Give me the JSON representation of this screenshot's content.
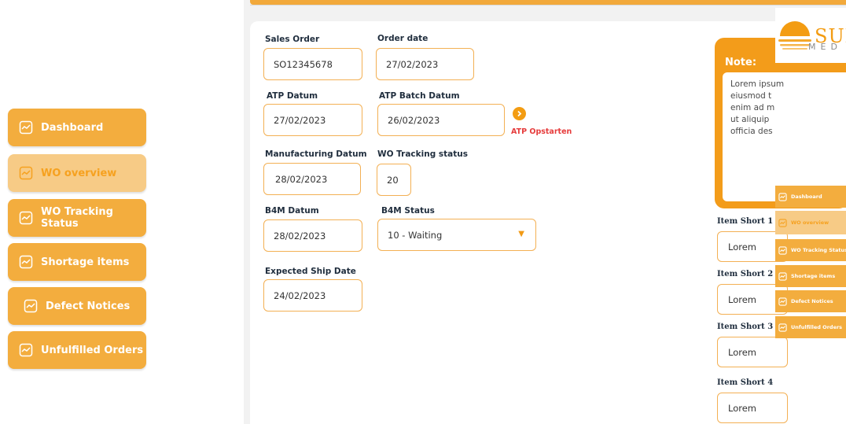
{
  "sidebar": {
    "items": [
      {
        "label": "Dashboard"
      },
      {
        "label": "WO overview"
      },
      {
        "label": "WO Tracking Status"
      },
      {
        "label": "Shortage items"
      },
      {
        "label": "Defect Notices"
      },
      {
        "label": "Unfulfilled Orders"
      }
    ],
    "active_index": 1
  },
  "form": {
    "sales_order": {
      "label": "Sales Order",
      "value": "SO12345678"
    },
    "order_date": {
      "label": "Order date",
      "value": "27/02/2023"
    },
    "atp_datum": {
      "label": "ATP Datum",
      "value": "27/02/2023"
    },
    "atp_batch_datum": {
      "label": "ATP Batch Datum",
      "value": "26/02/2023"
    },
    "atp_action": {
      "label": "ATP Opstarten"
    },
    "manufacturing_datum": {
      "label": "Manufacturing Datum",
      "value": "28/02/2023"
    },
    "wo_tracking_status": {
      "label": "WO Tracking status",
      "value": "20"
    },
    "b4m_datum": {
      "label": "B4M Datum",
      "value": "28/02/2023"
    },
    "b4m_status": {
      "label": "B4M Status",
      "value": "10 - Waiting"
    },
    "expected_ship_date": {
      "label": "Expected Ship Date",
      "value": "24/02/2023"
    }
  },
  "note": {
    "title": "Note:",
    "body": "Lorem ipsum\neiusmod t\nenim ad m\nut aliquip\nofficia des"
  },
  "items": [
    {
      "label": "Item Short 1",
      "value": "Lorem"
    },
    {
      "label": "Item Short 2",
      "value": "Lorem"
    },
    {
      "label": "Item Short 3",
      "value": "Lorem"
    },
    {
      "label": "Item Short 4",
      "value": "Lorem"
    }
  ],
  "logo": {
    "line1": "SUN",
    "line2": "MED"
  },
  "right_nav": {
    "items": [
      {
        "label": "Dashboard"
      },
      {
        "label": "WO overview"
      },
      {
        "label": "WO Tracking Status"
      },
      {
        "label": "Shortage items"
      },
      {
        "label": "Defect Notices"
      },
      {
        "label": "Unfulfilled Orders"
      }
    ],
    "active_index": 1
  },
  "colors": {
    "accent": "#f3ad3e",
    "accent_active": "#f7cb86",
    "alert": "#e63c3c"
  }
}
